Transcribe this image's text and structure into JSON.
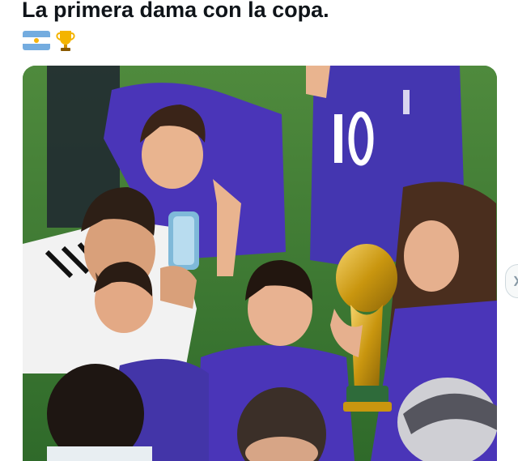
{
  "post": {
    "text": "La primera dama con la copa.",
    "emojis": [
      "argentina-flag",
      "trophy"
    ]
  },
  "photo": {
    "subject": "soccer-celebration-photo",
    "jersey_number": "10"
  },
  "carousel": {
    "next_icon": "chevron-right"
  },
  "colors": {
    "text": "#0f1419",
    "flag_blue": "#74acdf",
    "flag_sun": "#f6b40e",
    "trophy_gold": "#d4a21a",
    "jersey_purple": "#4a35b8",
    "grass": "#3d7a33"
  }
}
